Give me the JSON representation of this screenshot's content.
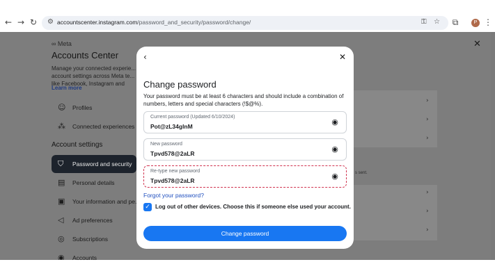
{
  "browser": {
    "url_domain": "accountscenter.instagram.com",
    "url_path": "/password_and_security/password/change/",
    "avatar_letter": "P"
  },
  "background": {
    "brand": "Meta",
    "title": "Accounts Center",
    "description": "Manage your connected experie... account settings across Meta te... like Facebook, Instagram and Me...",
    "learn_more": "Learn more",
    "nav_items": [
      {
        "label": "Profiles",
        "icon": "person-icon"
      },
      {
        "label": "Connected experiences",
        "icon": "connected-icon"
      }
    ],
    "section_heading": "Account settings",
    "settings_items": [
      {
        "label": "Password and security",
        "icon": "shield-icon",
        "active": true
      },
      {
        "label": "Personal details",
        "icon": "id-card-icon"
      },
      {
        "label": "Your information and pe...",
        "icon": "info-icon"
      },
      {
        "label": "Ad preferences",
        "icon": "megaphone-icon"
      },
      {
        "label": "Subscriptions",
        "icon": "subscriptions-icon"
      },
      {
        "label": "Accounts",
        "icon": "account-icon"
      }
    ],
    "partial_text": "s sent."
  },
  "modal": {
    "title": "Change password",
    "description": "Your password must be at least 6 characters and should include a combination of numbers, letters and special characters (!$@%).",
    "fields": [
      {
        "label": "Current password (Updated 6/10/2024)",
        "value": "Pot@zL34glnM"
      },
      {
        "label": "New password",
        "value": "Tpvd578@2aLR"
      },
      {
        "label": "Re-type new password",
        "value": "Tpvd578@2aLR"
      }
    ],
    "forgot_link": "Forgot your password?",
    "logout_checkbox": {
      "label": "Log out of other devices. Choose this if someone else used your account.",
      "checked": true
    },
    "submit_label": "Change password"
  },
  "colors": {
    "primary": "#1877f2",
    "highlight": "#d0314d",
    "overlay": "#7d7d7d"
  }
}
